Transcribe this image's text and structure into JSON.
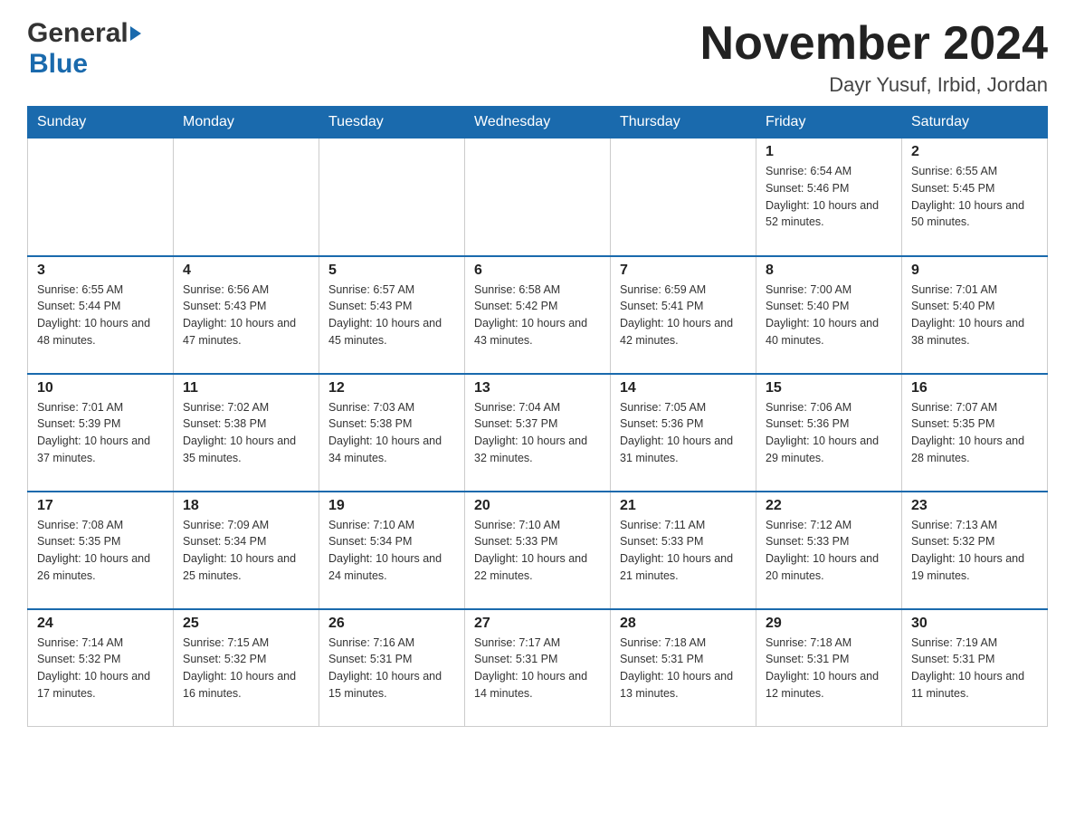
{
  "header": {
    "title": "November 2024",
    "location": "Dayr Yusuf, Irbid, Jordan",
    "logo_general": "General",
    "logo_blue": "Blue"
  },
  "weekdays": [
    "Sunday",
    "Monday",
    "Tuesday",
    "Wednesday",
    "Thursday",
    "Friday",
    "Saturday"
  ],
  "weeks": [
    [
      {
        "day": "",
        "sunrise": "",
        "sunset": "",
        "daylight": ""
      },
      {
        "day": "",
        "sunrise": "",
        "sunset": "",
        "daylight": ""
      },
      {
        "day": "",
        "sunrise": "",
        "sunset": "",
        "daylight": ""
      },
      {
        "day": "",
        "sunrise": "",
        "sunset": "",
        "daylight": ""
      },
      {
        "day": "",
        "sunrise": "",
        "sunset": "",
        "daylight": ""
      },
      {
        "day": "1",
        "sunrise": "Sunrise: 6:54 AM",
        "sunset": "Sunset: 5:46 PM",
        "daylight": "Daylight: 10 hours and 52 minutes."
      },
      {
        "day": "2",
        "sunrise": "Sunrise: 6:55 AM",
        "sunset": "Sunset: 5:45 PM",
        "daylight": "Daylight: 10 hours and 50 minutes."
      }
    ],
    [
      {
        "day": "3",
        "sunrise": "Sunrise: 6:55 AM",
        "sunset": "Sunset: 5:44 PM",
        "daylight": "Daylight: 10 hours and 48 minutes."
      },
      {
        "day": "4",
        "sunrise": "Sunrise: 6:56 AM",
        "sunset": "Sunset: 5:43 PM",
        "daylight": "Daylight: 10 hours and 47 minutes."
      },
      {
        "day": "5",
        "sunrise": "Sunrise: 6:57 AM",
        "sunset": "Sunset: 5:43 PM",
        "daylight": "Daylight: 10 hours and 45 minutes."
      },
      {
        "day": "6",
        "sunrise": "Sunrise: 6:58 AM",
        "sunset": "Sunset: 5:42 PM",
        "daylight": "Daylight: 10 hours and 43 minutes."
      },
      {
        "day": "7",
        "sunrise": "Sunrise: 6:59 AM",
        "sunset": "Sunset: 5:41 PM",
        "daylight": "Daylight: 10 hours and 42 minutes."
      },
      {
        "day": "8",
        "sunrise": "Sunrise: 7:00 AM",
        "sunset": "Sunset: 5:40 PM",
        "daylight": "Daylight: 10 hours and 40 minutes."
      },
      {
        "day": "9",
        "sunrise": "Sunrise: 7:01 AM",
        "sunset": "Sunset: 5:40 PM",
        "daylight": "Daylight: 10 hours and 38 minutes."
      }
    ],
    [
      {
        "day": "10",
        "sunrise": "Sunrise: 7:01 AM",
        "sunset": "Sunset: 5:39 PM",
        "daylight": "Daylight: 10 hours and 37 minutes."
      },
      {
        "day": "11",
        "sunrise": "Sunrise: 7:02 AM",
        "sunset": "Sunset: 5:38 PM",
        "daylight": "Daylight: 10 hours and 35 minutes."
      },
      {
        "day": "12",
        "sunrise": "Sunrise: 7:03 AM",
        "sunset": "Sunset: 5:38 PM",
        "daylight": "Daylight: 10 hours and 34 minutes."
      },
      {
        "day": "13",
        "sunrise": "Sunrise: 7:04 AM",
        "sunset": "Sunset: 5:37 PM",
        "daylight": "Daylight: 10 hours and 32 minutes."
      },
      {
        "day": "14",
        "sunrise": "Sunrise: 7:05 AM",
        "sunset": "Sunset: 5:36 PM",
        "daylight": "Daylight: 10 hours and 31 minutes."
      },
      {
        "day": "15",
        "sunrise": "Sunrise: 7:06 AM",
        "sunset": "Sunset: 5:36 PM",
        "daylight": "Daylight: 10 hours and 29 minutes."
      },
      {
        "day": "16",
        "sunrise": "Sunrise: 7:07 AM",
        "sunset": "Sunset: 5:35 PM",
        "daylight": "Daylight: 10 hours and 28 minutes."
      }
    ],
    [
      {
        "day": "17",
        "sunrise": "Sunrise: 7:08 AM",
        "sunset": "Sunset: 5:35 PM",
        "daylight": "Daylight: 10 hours and 26 minutes."
      },
      {
        "day": "18",
        "sunrise": "Sunrise: 7:09 AM",
        "sunset": "Sunset: 5:34 PM",
        "daylight": "Daylight: 10 hours and 25 minutes."
      },
      {
        "day": "19",
        "sunrise": "Sunrise: 7:10 AM",
        "sunset": "Sunset: 5:34 PM",
        "daylight": "Daylight: 10 hours and 24 minutes."
      },
      {
        "day": "20",
        "sunrise": "Sunrise: 7:10 AM",
        "sunset": "Sunset: 5:33 PM",
        "daylight": "Daylight: 10 hours and 22 minutes."
      },
      {
        "day": "21",
        "sunrise": "Sunrise: 7:11 AM",
        "sunset": "Sunset: 5:33 PM",
        "daylight": "Daylight: 10 hours and 21 minutes."
      },
      {
        "day": "22",
        "sunrise": "Sunrise: 7:12 AM",
        "sunset": "Sunset: 5:33 PM",
        "daylight": "Daylight: 10 hours and 20 minutes."
      },
      {
        "day": "23",
        "sunrise": "Sunrise: 7:13 AM",
        "sunset": "Sunset: 5:32 PM",
        "daylight": "Daylight: 10 hours and 19 minutes."
      }
    ],
    [
      {
        "day": "24",
        "sunrise": "Sunrise: 7:14 AM",
        "sunset": "Sunset: 5:32 PM",
        "daylight": "Daylight: 10 hours and 17 minutes."
      },
      {
        "day": "25",
        "sunrise": "Sunrise: 7:15 AM",
        "sunset": "Sunset: 5:32 PM",
        "daylight": "Daylight: 10 hours and 16 minutes."
      },
      {
        "day": "26",
        "sunrise": "Sunrise: 7:16 AM",
        "sunset": "Sunset: 5:31 PM",
        "daylight": "Daylight: 10 hours and 15 minutes."
      },
      {
        "day": "27",
        "sunrise": "Sunrise: 7:17 AM",
        "sunset": "Sunset: 5:31 PM",
        "daylight": "Daylight: 10 hours and 14 minutes."
      },
      {
        "day": "28",
        "sunrise": "Sunrise: 7:18 AM",
        "sunset": "Sunset: 5:31 PM",
        "daylight": "Daylight: 10 hours and 13 minutes."
      },
      {
        "day": "29",
        "sunrise": "Sunrise: 7:18 AM",
        "sunset": "Sunset: 5:31 PM",
        "daylight": "Daylight: 10 hours and 12 minutes."
      },
      {
        "day": "30",
        "sunrise": "Sunrise: 7:19 AM",
        "sunset": "Sunset: 5:31 PM",
        "daylight": "Daylight: 10 hours and 11 minutes."
      }
    ]
  ],
  "colors": {
    "header_bg": "#1a6aad",
    "header_text": "#ffffff",
    "accent_blue": "#1a6aad"
  }
}
